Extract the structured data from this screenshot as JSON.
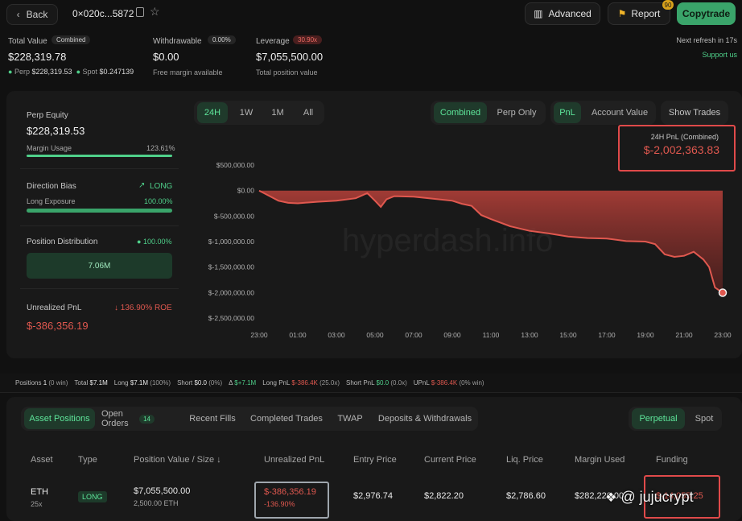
{
  "header": {
    "back_label": "Back",
    "address": "0×020c...5872",
    "advanced_label": "Advanced",
    "report_label": "Report",
    "report_badge": "90",
    "copytrade_label": "Copytrade",
    "refresh_text": "Next refresh in 17s",
    "support_label": "Support us"
  },
  "stats": {
    "total_value_label": "Total Value",
    "total_value_badge": "Combined",
    "total_value": "$228,319.78",
    "perp_label": "Perp",
    "perp_value": "$228,319.53",
    "spot_label": "Spot",
    "spot_value": "$0.247139",
    "withdrawable_label": "Withdrawable",
    "withdrawable_badge": "0.00%",
    "withdrawable_value": "$0.00",
    "free_margin_label": "Free margin available",
    "leverage_label": "Leverage",
    "leverage_badge": "30.90x",
    "leverage_value": "$7,055,500.00",
    "total_position_label": "Total position value"
  },
  "left_panel": {
    "perp_equity_label": "Perp Equity",
    "perp_equity_value": "$228,319.53",
    "margin_usage_label": "Margin Usage",
    "margin_usage_value": "123.61%",
    "direction_bias_label": "Direction Bias",
    "direction_value": "LONG",
    "long_exposure_label": "Long Exposure",
    "long_exposure_value": "100.00%",
    "position_distribution_label": "Position Distribution",
    "position_distribution_value": "100.00%",
    "distribution_bar_label": "7.06M",
    "unrealized_pnl_label": "Unrealized PnL",
    "roe_value": "136.90% ROE",
    "unrealized_pnl_value": "$-386,356.19"
  },
  "chart_controls": {
    "time_tabs": [
      "24H",
      "1W",
      "1M",
      "All"
    ],
    "active_time_tab": "24H",
    "mode_tabs": [
      "Combined",
      "Perp Only"
    ],
    "active_mode": "Combined",
    "metric_tabs": [
      "PnL",
      "Account Value"
    ],
    "active_metric": "PnL",
    "show_trades_label": "Show Trades",
    "summary_label": "24H PnL (Combined)",
    "summary_value": "$-2,002,363.83",
    "watermark": "hyperdash.info"
  },
  "chart_data": {
    "type": "area",
    "y_tick_labels": [
      "$500,000.00",
      "$0.00",
      "$-500,000.00",
      "$-1,000,000.00",
      "$-1,500,000.00",
      "$-2,000,000.00",
      "$-2,500,000.00"
    ],
    "y_ticks": [
      500000,
      0,
      -500000,
      -1000000,
      -1500000,
      -2000000,
      -2500000
    ],
    "ylim": [
      -2500000,
      500000
    ],
    "x_tick_labels": [
      "23:00",
      "01:00",
      "03:00",
      "05:00",
      "07:00",
      "09:00",
      "11:00",
      "13:00",
      "15:00",
      "17:00",
      "19:00",
      "21:00",
      "23:00"
    ],
    "xlim": [
      0,
      24
    ],
    "x": [
      0,
      0.5,
      1,
      1.5,
      2,
      3,
      4,
      5,
      5.6,
      6,
      6.3,
      6.6,
      7,
      8,
      9,
      10,
      10.5,
      11,
      11.5,
      12,
      13,
      14,
      15,
      16,
      17,
      18,
      19,
      20,
      20.5,
      21,
      21.5,
      22,
      22.5,
      23,
      23.3,
      23.6,
      24
    ],
    "values": [
      0,
      -100000,
      -200000,
      -240000,
      -250000,
      -220000,
      -200000,
      -150000,
      -50000,
      -200000,
      -320000,
      -170000,
      -110000,
      -120000,
      -160000,
      -200000,
      -260000,
      -300000,
      -480000,
      -560000,
      -700000,
      -790000,
      -840000,
      -900000,
      -930000,
      -940000,
      -990000,
      -1000000,
      -1050000,
      -1250000,
      -1300000,
      -1280000,
      -1200000,
      -1350000,
      -1500000,
      -1900000,
      -2002364
    ],
    "line_color": "#e0584f"
  },
  "positions_bar": {
    "positions_label": "Positions",
    "positions_value": "1",
    "positions_sub": "(0 win)",
    "total_label": "Total",
    "total_value": "$7.1M",
    "long_label": "Long",
    "long_value": "$7.1M",
    "long_sub": "(100%)",
    "short_label": "Short",
    "short_value": "$0.0",
    "short_sub": "(0%)",
    "delta_label": "Δ",
    "delta_value": "$+7.1M",
    "long_pnl_label": "Long PnL",
    "long_pnl_value": "$-386.4K",
    "long_pnl_sub": "(25.0x)",
    "short_pnl_label": "Short PnL",
    "short_pnl_value": "$0.0",
    "short_pnl_sub": "(0.0x)",
    "upnl_label": "UPnL",
    "upnl_value": "$-386.4K",
    "upnl_sub": "(0% win)"
  },
  "table_tabs": {
    "tabs": [
      "Asset Positions",
      "Open Orders",
      "Recent Fills",
      "Completed Trades",
      "TWAP",
      "Deposits & Withdrawals"
    ],
    "open_orders_count": "14",
    "active_tab": "Asset Positions",
    "market_tabs": [
      "Perpetual",
      "Spot"
    ],
    "active_market": "Perpetual"
  },
  "table": {
    "headers": [
      "Asset",
      "Type",
      "Position Value / Size",
      "Unrealized PnL",
      "Entry Price",
      "Current Price",
      "Liq. Price",
      "Margin Used",
      "Funding"
    ],
    "rows": [
      {
        "asset": "ETH",
        "leverage": "25x",
        "type": "LONG",
        "position_value": "$7,055,500.00",
        "size": "2,500.00 ETH",
        "unrealized_pnl": "$-386,356.19",
        "pnl_pct": "-136.90%",
        "entry_price": "$2,976.74",
        "current_price": "$2,822.20",
        "liq_price": "$2,786.60",
        "margin_used": "$282,220.00",
        "funding": "$-14,055.25"
      }
    ]
  },
  "overlay": {
    "watermark_text": "@ jujucrypt"
  },
  "colors": {
    "accent_green": "#4fd08a",
    "loss_red": "#e0584f",
    "highlight_box": "#e04a4a"
  }
}
